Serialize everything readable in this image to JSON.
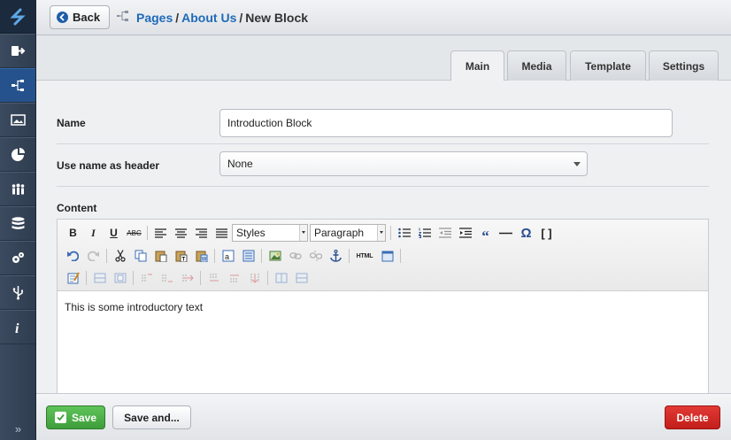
{
  "header": {
    "back_label": "Back",
    "breadcrumb": [
      {
        "label": "Pages",
        "link": true
      },
      {
        "label": "About Us",
        "link": true
      },
      {
        "label": "New Block",
        "link": false
      }
    ],
    "separator": "/"
  },
  "sidebar": {
    "items": [
      {
        "icon": "logo-icon"
      },
      {
        "icon": "logout-icon"
      },
      {
        "icon": "sitemap-icon",
        "active": true
      },
      {
        "icon": "image-icon"
      },
      {
        "icon": "pie-chart-icon"
      },
      {
        "icon": "users-icon"
      },
      {
        "icon": "database-icon"
      },
      {
        "icon": "gears-icon"
      },
      {
        "icon": "usb-icon"
      },
      {
        "icon": "info-icon"
      }
    ],
    "collapse_label": "»"
  },
  "tabs": [
    {
      "label": "Main",
      "active": true
    },
    {
      "label": "Media",
      "active": false
    },
    {
      "label": "Template",
      "active": false
    },
    {
      "label": "Settings",
      "active": false
    }
  ],
  "form": {
    "name_label": "Name",
    "name_value": "Introduction Block",
    "header_label": "Use name as header",
    "header_value": "None",
    "content_label": "Content"
  },
  "editor": {
    "styles_label": "Styles",
    "format_label": "Paragraph",
    "body_text": "This is some introductory text",
    "bold_label": "B",
    "italic_label": "I",
    "underline_label": "U",
    "strike_label": "ABC",
    "html_label": "HTML"
  },
  "footer": {
    "save_label": "Save",
    "save_and_label": "Save and...",
    "delete_label": "Delete"
  },
  "colors": {
    "link": "#1f6bb8",
    "save": "#4cae47",
    "delete": "#d42b26",
    "sidebar_active": "#25528c"
  }
}
